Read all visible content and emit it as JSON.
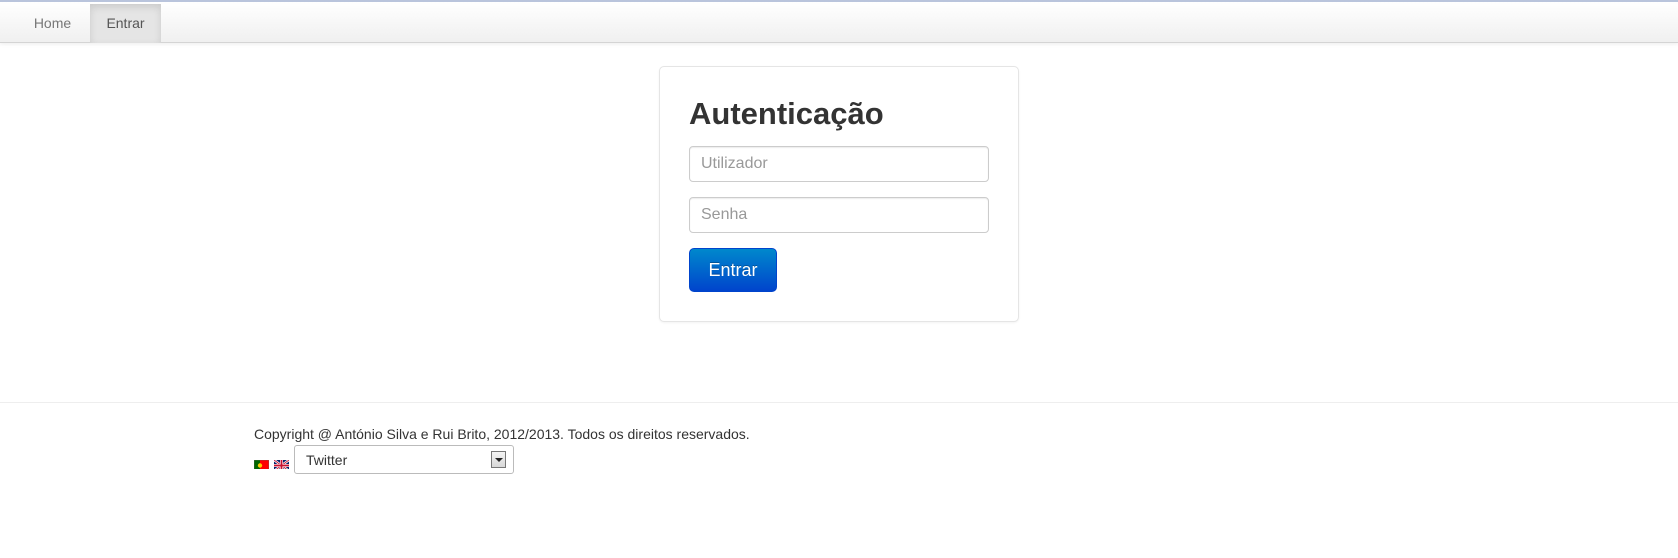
{
  "nav": {
    "items": [
      {
        "label": "Home",
        "active": false
      },
      {
        "label": "Entrar",
        "active": true
      }
    ]
  },
  "login": {
    "title": "Autenticação",
    "username_placeholder": "Utilizador",
    "username_value": "",
    "password_placeholder": "Senha",
    "password_value": "",
    "submit_label": "Entrar",
    "submit_color": "#0055cc"
  },
  "footer": {
    "copyright": "Copyright @ António Silva e Rui Brito, 2012/2013. Todos os direitos reservados.",
    "flags": [
      "portugal-flag-icon",
      "uk-flag-icon"
    ],
    "select": {
      "value": "Twitter"
    }
  }
}
